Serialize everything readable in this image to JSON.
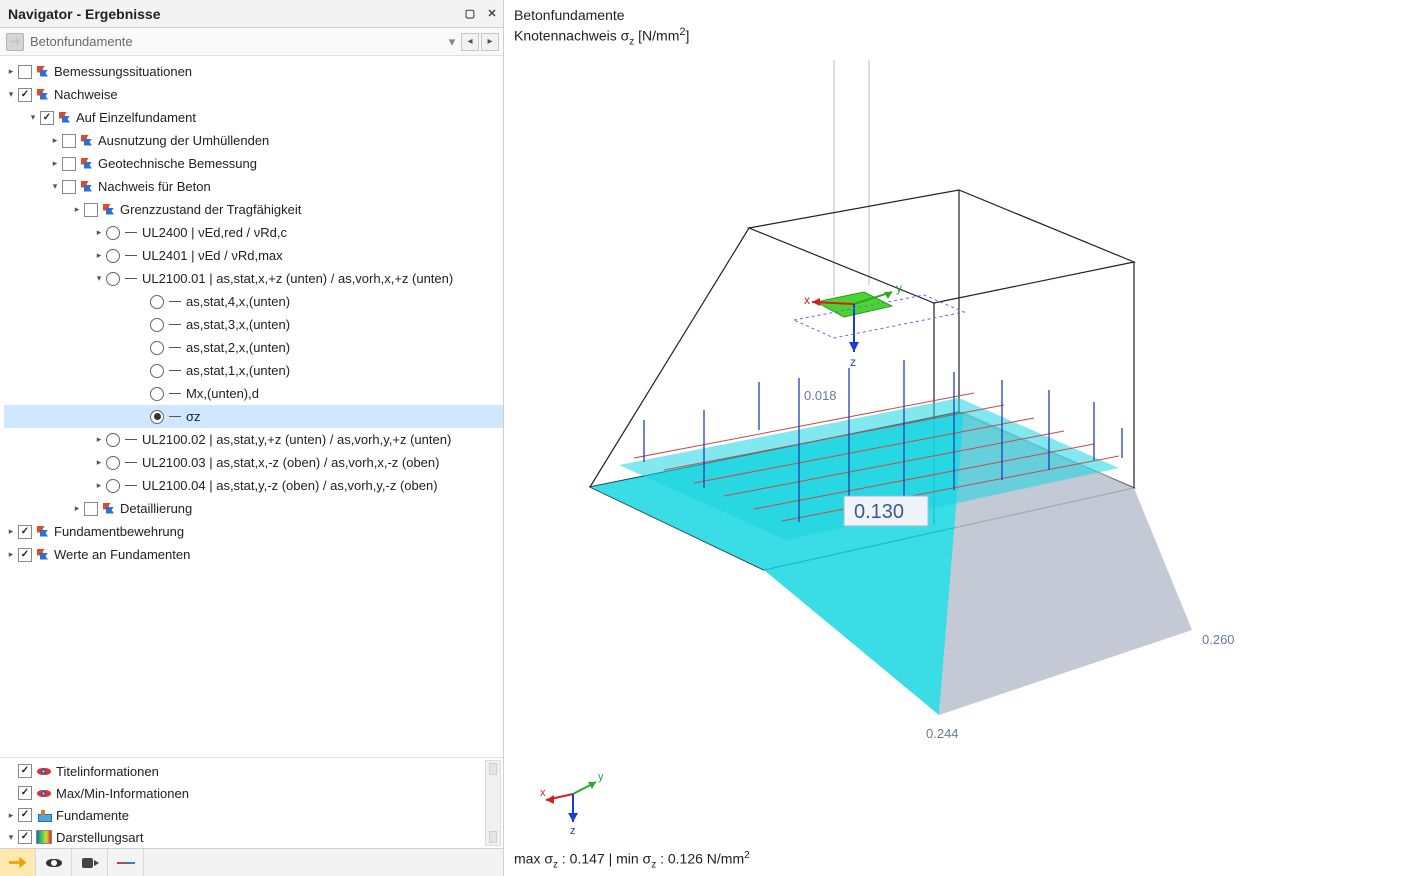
{
  "panel": {
    "title": "Navigator - Ergebnisse",
    "breadcrumb": "Betonfundamente"
  },
  "tree": {
    "bemess": "Bemessungssituationen",
    "nachw": "Nachweise",
    "einzel": "Auf Einzelfundament",
    "ausnutz": "Ausnutzung der Umhüllenden",
    "geo": "Geotechnische Bemessung",
    "beton": "Nachweis für Beton",
    "grenz": "Grenzzustand der Tragfähigkeit",
    "ul2400": "UL2400 | νEd,red / νRd,c",
    "ul2401": "UL2401 | νEd / νRd,max",
    "ul2100_01": "UL2100.01 | as,stat,x,+z (unten) / as,vorh,x,+z (unten)",
    "as4": "as,stat,4,x,(unten)",
    "as3": "as,stat,3,x,(unten)",
    "as2": "as,stat,2,x,(unten)",
    "as1": "as,stat,1,x,(unten)",
    "mx": "Mx,(unten),d",
    "sigma": "σz",
    "ul2100_02": "UL2100.02 | as,stat,y,+z (unten) / as,vorh,y,+z (unten)",
    "ul2100_03": "UL2100.03 | as,stat,x,-z (oben) / as,vorh,x,-z (oben)",
    "ul2100_04": "UL2100.04 | as,stat,y,-z (oben) / as,vorh,y,-z (oben)",
    "detail": "Detaillierung",
    "fundbew": "Fundamentbewehrung",
    "werte": "Werte an Fundamenten"
  },
  "bottom": {
    "titel": "Titelinformationen",
    "maxmin": "Max/Min-Informationen",
    "fund": "Fundamente",
    "darst": "Darstellungsart"
  },
  "viewport": {
    "title1": "Betonfundamente",
    "title2_prefix": "Knotennachweis σ",
    "title2_sub": "z",
    "title2_unit": " [N/mm",
    "title2_sq": "2",
    "title2_close": "]",
    "footer_prefix": "max σ",
    "footer_sub1": "z",
    "footer_mid": " : 0.147 | min σ",
    "footer_sub2": "z",
    "footer_end": " : 0.126 N/mm",
    "footer_sq": "2",
    "annot_top": "0.018",
    "annot_mid": "0.130",
    "annot_bl": "0.244",
    "annot_br": "0.260",
    "axis_x": "x",
    "axis_y": "y",
    "axis_z": "z",
    "triad_x": "x",
    "triad_y": "y",
    "triad_z": "z"
  }
}
